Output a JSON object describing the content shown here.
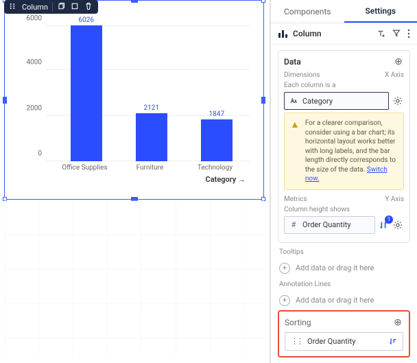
{
  "widget_toolbar": {
    "type_label": "Column"
  },
  "chart_data": {
    "type": "bar",
    "title": "Order Quantity",
    "categories": [
      "Office Supplies",
      "Furniture",
      "Technology"
    ],
    "values": [
      6026,
      2121,
      1847
    ],
    "xlabel": "Category",
    "ylabel": "",
    "ylim": [
      0,
      6500
    ],
    "yticks": [
      0,
      2000,
      4000,
      6000
    ]
  },
  "tabs": {
    "components": "Components",
    "settings": "Settings"
  },
  "viz_header": {
    "type": "Column"
  },
  "data_section": {
    "title": "Data",
    "dimensions_label": "Dimensions",
    "dimensions_axis": "X Axis",
    "each_column": "Each column is a",
    "dimension_value": "Category",
    "hint": "For a clearer comparison, consider using a bar chart; its horizontal layout works better with long labels, and the bar length directly corresponds to the size of the data.",
    "hint_link": "Switch now.",
    "metrics_label": "Metrics",
    "metrics_axis": "Y Axis",
    "column_height_shows": "Column height shows",
    "metric_value": "Order Quantity"
  },
  "tooltips_section": {
    "title": "Tooltips",
    "placeholder": "Add data or drag it here"
  },
  "annotation_section": {
    "title": "Annotation Lines",
    "placeholder": "Add data or drag it here"
  },
  "sorting_section": {
    "title": "Sorting",
    "value": "Order Quantity"
  }
}
